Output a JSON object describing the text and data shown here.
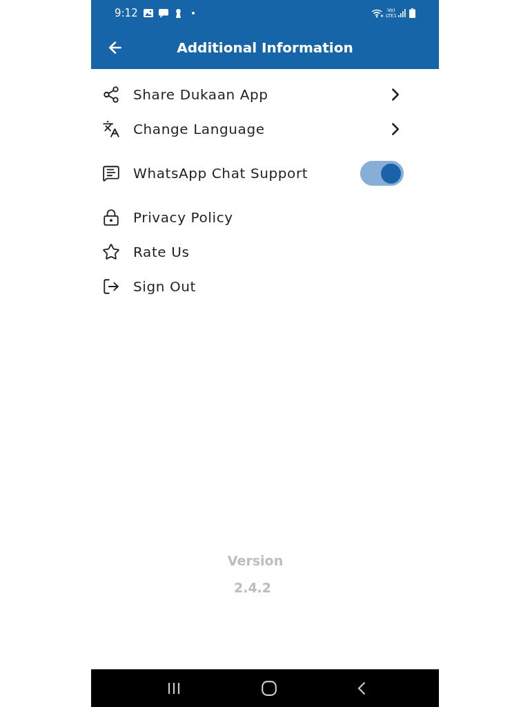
{
  "status_bar": {
    "time": "9:12",
    "network_top": "Vo)",
    "network_bottom": "LTE1"
  },
  "app_bar": {
    "title": "Additional Information"
  },
  "menu_items": [
    {
      "kind": "link",
      "label": "Share Dukaan App"
    },
    {
      "kind": "link",
      "label": "Change Language"
    },
    {
      "kind": "toggle",
      "label": "WhatsApp Chat Support",
      "on": true
    },
    {
      "kind": "plain",
      "label": "Privacy Policy"
    },
    {
      "kind": "plain",
      "label": "Rate Us"
    },
    {
      "kind": "plain",
      "label": "Sign Out"
    }
  ],
  "version": {
    "label": "Version",
    "number": "2.4.2"
  }
}
